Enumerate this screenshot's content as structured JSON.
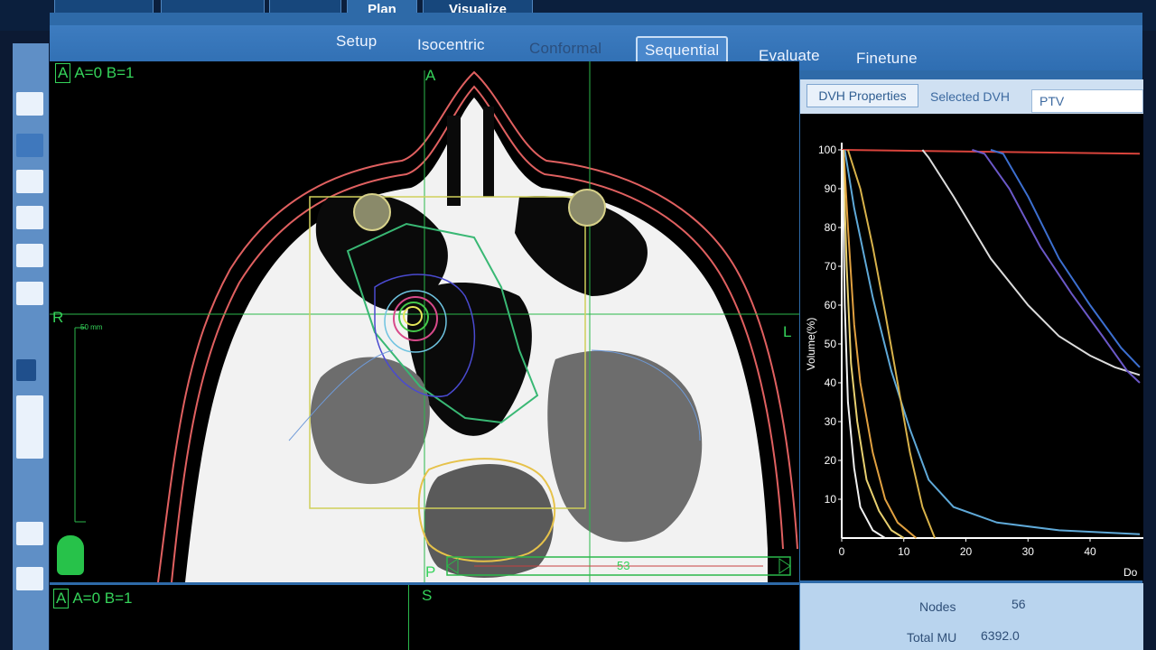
{
  "top_tabs": [
    "Plan",
    "Visualize"
  ],
  "subtabs": {
    "setup": "Setup",
    "isocentric": "Isocentric",
    "conformal": "Conformal",
    "sequential": "Sequential",
    "evaluate": "Evaluate",
    "finetune": "Finetune"
  },
  "axial_view": {
    "tag": "A",
    "label": "A=0 B=1",
    "orient_top": "A",
    "orient_left": "R",
    "orient_right": "L",
    "orient_bottom": "P",
    "ruler_label": "50 mm",
    "slider_value": "53"
  },
  "lower_view": {
    "tag": "A",
    "label": "A=0 B=1",
    "orient_top": "S"
  },
  "dvh": {
    "properties_button": "DVH Properties",
    "selected_label": "Selected DVH",
    "selected_value": "PTV"
  },
  "chart_data": {
    "type": "line",
    "ylabel": "Volume(%)",
    "xlabel": "Do",
    "xlim": [
      0,
      48
    ],
    "ylim": [
      0,
      100
    ],
    "x_ticks": [
      0,
      10,
      20,
      30,
      40
    ],
    "y_ticks": [
      10,
      20,
      30,
      40,
      50,
      60,
      70,
      80,
      90,
      100
    ],
    "grid": false,
    "series": [
      {
        "color": "#d9443c",
        "x": [
          0,
          48
        ],
        "y": [
          100,
          99
        ]
      },
      {
        "color": "#dcdcdc",
        "x": [
          13,
          14,
          18,
          24,
          30,
          35,
          40,
          44,
          48
        ],
        "y": [
          100,
          98,
          88,
          72,
          60,
          52,
          47,
          44,
          42
        ]
      },
      {
        "color": "#6b58c8",
        "x": [
          21,
          23,
          27,
          32,
          37,
          42,
          46,
          48
        ],
        "y": [
          100,
          99,
          90,
          75,
          63,
          52,
          43,
          40
        ]
      },
      {
        "color": "#3c6fd0",
        "x": [
          24,
          26,
          30,
          35,
          40,
          45,
          48
        ],
        "y": [
          100,
          99,
          88,
          72,
          60,
          49,
          44
        ]
      },
      {
        "color": "#5fa9d8",
        "x": [
          0.5,
          2,
          5,
          8,
          11,
          14,
          18,
          25,
          35,
          48
        ],
        "y": [
          100,
          85,
          62,
          43,
          28,
          15,
          8,
          4,
          2,
          1
        ]
      },
      {
        "color": "#d8b24a",
        "x": [
          1,
          3,
          5,
          7,
          9,
          11,
          13,
          15
        ],
        "y": [
          100,
          90,
          75,
          58,
          40,
          22,
          8,
          0
        ]
      },
      {
        "color": "#e0a040",
        "x": [
          0.3,
          1,
          2,
          3,
          5,
          7,
          9,
          12
        ],
        "y": [
          100,
          80,
          55,
          40,
          22,
          10,
          4,
          0
        ]
      },
      {
        "color": "#e8d070",
        "x": [
          0.2,
          0.8,
          1.5,
          2.5,
          4,
          6,
          8,
          10
        ],
        "y": [
          100,
          70,
          45,
          30,
          15,
          7,
          2,
          0
        ]
      },
      {
        "color": "#f0f0f0",
        "x": [
          0.1,
          0.5,
          1,
          2,
          3,
          5,
          7
        ],
        "y": [
          100,
          60,
          35,
          18,
          8,
          2,
          0
        ]
      }
    ]
  },
  "stats": {
    "nodes_label": "Nodes",
    "nodes_value": "56",
    "mu_label": "Total MU",
    "mu_value": "6392.0"
  }
}
